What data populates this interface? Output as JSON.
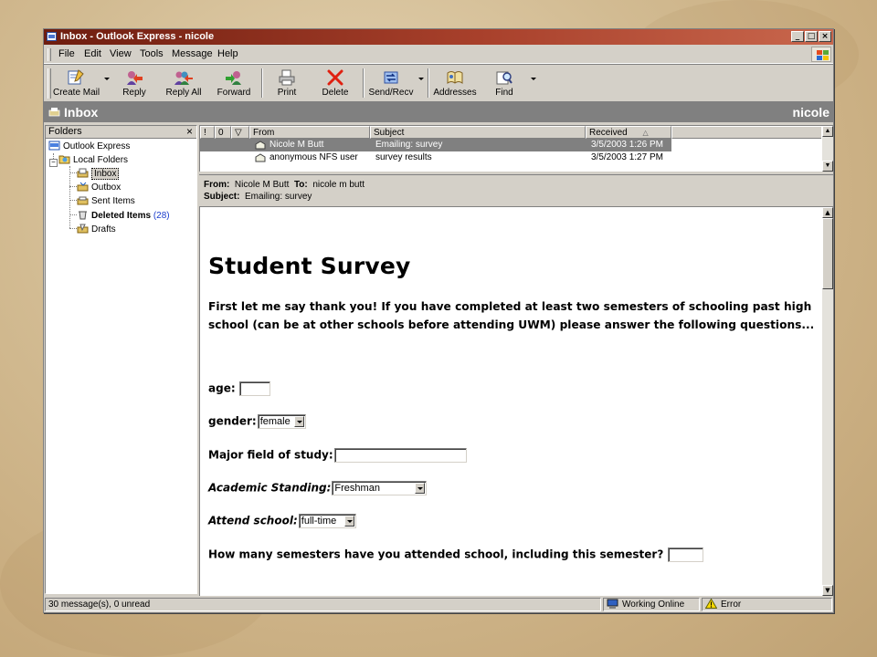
{
  "window": {
    "title": "Inbox - Outlook Express - nicole",
    "buttons": {
      "minimize": "_",
      "maximize": "□",
      "close": "×"
    }
  },
  "menubar": {
    "items": [
      "File",
      "Edit",
      "View",
      "Tools",
      "Message",
      "Help"
    ]
  },
  "toolbar": {
    "create_mail": "Create Mail",
    "reply": "Reply",
    "reply_all": "Reply All",
    "forward": "Forward",
    "print": "Print",
    "delete": "Delete",
    "send_recv": "Send/Recv",
    "addresses": "Addresses",
    "find": "Find"
  },
  "banner": {
    "title": "Inbox",
    "user": "nicole"
  },
  "folders": {
    "header": "Folders",
    "close_glyph": "×",
    "items": [
      {
        "label": "Outlook Express"
      },
      {
        "label": "Local Folders"
      },
      {
        "label": "Inbox"
      },
      {
        "label": "Outbox"
      },
      {
        "label": "Sent Items"
      },
      {
        "label": "Deleted Items",
        "count": "(28)"
      },
      {
        "label": "Drafts"
      }
    ]
  },
  "message_list": {
    "columns": {
      "priority": "!",
      "attachment": "0",
      "flag": "▽",
      "from": "From",
      "subject": "Subject",
      "received": "Received",
      "sort_glyph": "△"
    },
    "rows": [
      {
        "from": "Nicole M Butt",
        "subject": "Emailing: survey",
        "received": "3/5/2003 1:26 PM",
        "selected": true
      },
      {
        "from": "anonymous NFS user",
        "subject": "survey results",
        "received": "3/5/2003 1:27 PM",
        "selected": false
      }
    ]
  },
  "preview_header": {
    "from_label": "From:",
    "from": "Nicole M Butt",
    "to_label": "To:",
    "to": "nicole m butt",
    "subject_label": "Subject:",
    "subject": "Emailing: survey"
  },
  "survey": {
    "title": "Student Survey",
    "intro": "First let me say thank you! If you have completed at least two semesters of schooling past high school (can be at other schools before attending UWM) please answer the following questions...",
    "age_label": "age:",
    "age_value": "",
    "gender_label": "gender:",
    "gender_value": "female",
    "major_label": "Major field of study:",
    "major_value": "",
    "standing_label": "Academic Standing:",
    "standing_value": "Freshman",
    "attend_label": "Attend school:",
    "attend_value": "full-time",
    "semesters_label": "How many semesters have you attended school, including this semester?",
    "semesters_value": ""
  },
  "statusbar": {
    "messages": "30 message(s), 0 unread",
    "connection": "Working Online",
    "error": "Error"
  },
  "colors": {
    "titlebar_start": "#6e1d0f",
    "titlebar_end": "#c9674d",
    "selection": "#808080",
    "count_link": "#1a3ccc"
  }
}
